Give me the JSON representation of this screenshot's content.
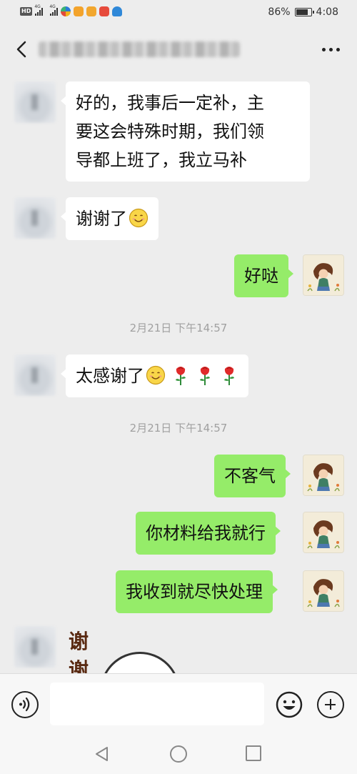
{
  "status_bar": {
    "badge": "HD",
    "signal_1_label": "4G",
    "signal_2_label": "4G",
    "battery_text": "86%",
    "battery_level": 0.86,
    "time": "4:08"
  },
  "header": {
    "title": "",
    "back_icon": "chevron-left-icon",
    "more_icon": "more-dots-icon"
  },
  "messages": [
    {
      "side": "left",
      "text": "好的，我事后一定补，主要这会特殊时期，我们领导都上班了，我立马补",
      "lines": [
        "好的，我事后一定补，主",
        "要这会特殊时期，我们领",
        "导都上班了，我立马补"
      ]
    },
    {
      "side": "left",
      "text": "谢谢了",
      "emoji": "smile-emoji"
    },
    {
      "side": "right",
      "text": "好哒"
    },
    {
      "side": "left",
      "text": "太感谢了",
      "emoji": "smile-emoji",
      "extra_emoji": [
        "rose-emoji",
        "rose-emoji",
        "rose-emoji"
      ]
    },
    {
      "side": "right",
      "text": "不客气"
    },
    {
      "side": "right",
      "text": "你材料给我就行"
    },
    {
      "side": "right",
      "text": "我收到就尽快处理"
    },
    {
      "side": "left",
      "type": "sticker",
      "text": "谢谢"
    }
  ],
  "timestamps": [
    "2月21日 下午14:57",
    "2月21日 下午14:57"
  ],
  "sticker_lines": [
    "谢",
    "谢"
  ],
  "input_bar": {
    "voice_icon": "voice-icon",
    "emoji_icon": "emoji-icon",
    "plus_icon": "plus-icon",
    "value": ""
  },
  "nav_bar": {
    "back_icon": "nav-back-icon",
    "home_icon": "nav-home-icon",
    "recent_icon": "nav-recent-icon"
  },
  "colors": {
    "background": "#ededed",
    "bubble_self": "#95ec69",
    "bubble_other": "#ffffff",
    "timestamp": "#a0a0a0"
  }
}
